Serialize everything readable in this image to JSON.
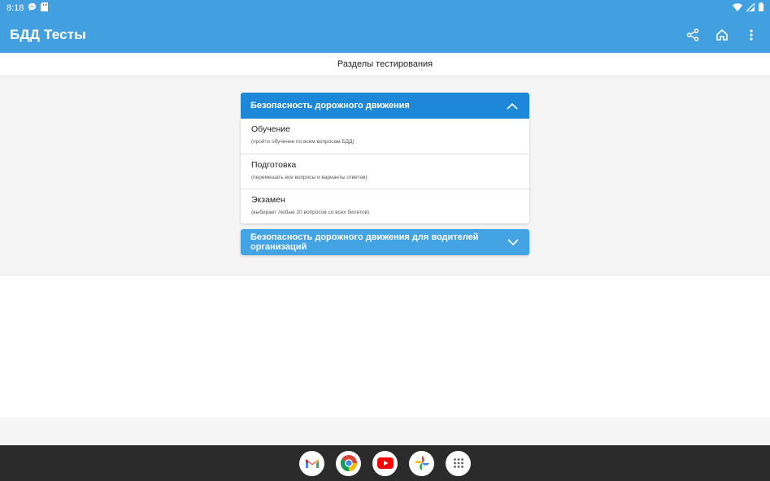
{
  "status_bar": {
    "time": "8:18",
    "left_icons": [
      "chat-bubble-icon",
      "sd-card-icon"
    ],
    "right_icons": [
      "wifi-icon",
      "signal-icon",
      "battery-icon"
    ]
  },
  "app_bar": {
    "title": "БДД Тесты",
    "actions": [
      "share-icon",
      "home-icon",
      "more-vert-icon"
    ],
    "color": "#42a0e0"
  },
  "subheader": {
    "title": "Разделы тестирования"
  },
  "sections": [
    {
      "title": "Безопасность дорожного движения",
      "expanded": true,
      "header_color": "#1e88d8",
      "items": [
        {
          "name": "Обучение",
          "description": "(пройти обучение по всем вопросам БДД)"
        },
        {
          "name": "Подготовка",
          "description": "(перемешать все вопросы и варианты ответов)"
        },
        {
          "name": "Экзамен",
          "description": "(выбирает любые 20 вопросов со всех билетов)"
        }
      ]
    },
    {
      "title": "Безопасность дорожного движения для водителей организаций",
      "expanded": false,
      "header_color": "#44a3e3"
    }
  ],
  "dock": {
    "apps": [
      "gmail-icon",
      "chrome-icon",
      "youtube-icon",
      "photos-icon",
      "app-drawer-icon"
    ]
  }
}
